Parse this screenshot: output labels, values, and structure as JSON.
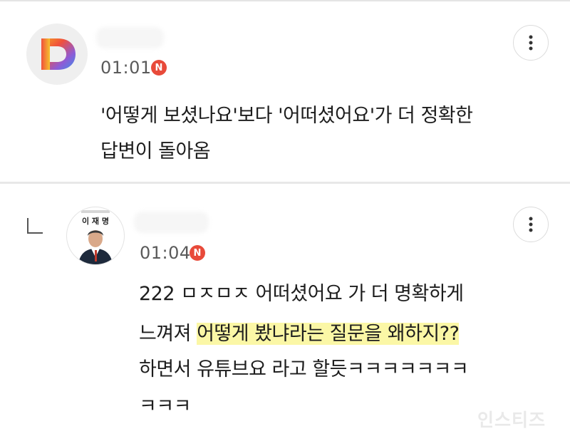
{
  "comments": [
    {
      "avatar_letter": "D",
      "time": "01:01",
      "new_badge": "N",
      "lines": [
        "'어떻게 보셨나요'보다 '어떠셨어요'가 더 정확한",
        "답변이 돌아옴"
      ]
    }
  ],
  "reply": {
    "avatar_caption": "이 재 명",
    "time": "01:04",
    "new_badge": "N",
    "line1": "222 ㅁㅈㅁㅈ 어떠셨어요 가 더 명확하게",
    "line2_prefix": "느껴져 ",
    "line2_highlight": "어떻게 봤냐라는 질문을 왜하지??",
    "line3": "하면서 유튜브요 라고 할듯ㅋㅋㅋㅋㅋㅋㅋ",
    "line4": "ㅋㅋㅋ"
  },
  "watermark": "인스티즈",
  "icons": {
    "more": "more-vertical-icon",
    "reply_arrow": "reply-arrow-icon",
    "new": "new-badge-icon"
  },
  "colors": {
    "highlight": "#fbf7a6",
    "badge": "#e84a3a"
  }
}
